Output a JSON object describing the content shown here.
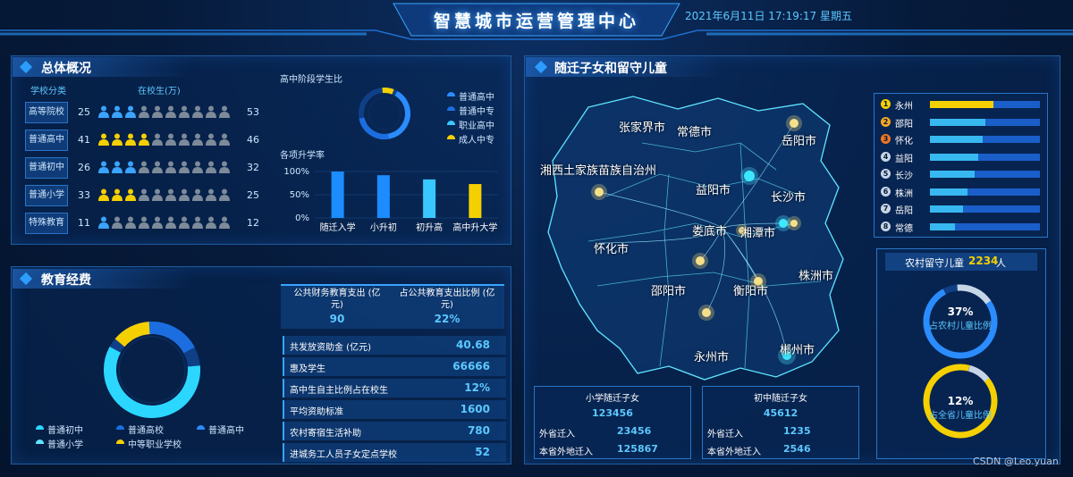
{
  "header": {
    "title": "智慧城市运营管理中心",
    "datetime": "2021年6月11日 17:19:17 星期五"
  },
  "overview": {
    "title": "总体概况",
    "col_category": "学校分类",
    "col_students": "在校生(万)",
    "rows": [
      {
        "label": "高等院校",
        "left": "25",
        "right": "53",
        "accent": "#3aa4ff"
      },
      {
        "label": "普通高中",
        "left": "41",
        "right": "46",
        "accent": "#f5d000"
      },
      {
        "label": "普通初中",
        "left": "26",
        "right": "32",
        "accent": "#3aa4ff"
      },
      {
        "label": "普通小学",
        "left": "33",
        "right": "25",
        "accent": "#f5d000"
      },
      {
        "label": "特殊教育",
        "left": "11",
        "right": "12",
        "accent": "#3aa4ff"
      }
    ],
    "donut_title": "高中阶段学生比",
    "donut_legend": [
      {
        "name": "普通高中",
        "color": "#2b8cff"
      },
      {
        "name": "普通中专",
        "color": "#1c6ee0"
      },
      {
        "name": "职业高中",
        "color": "#38c8ff"
      },
      {
        "name": "成人中专",
        "color": "#f5d000"
      }
    ],
    "bar_title": "各项升学率"
  },
  "chart_data": {
    "type": "bar",
    "categories": [
      "随迁入学",
      "小升初",
      "初升高",
      "高中升大学"
    ],
    "values": [
      100,
      92,
      83,
      73
    ],
    "colors": [
      "#1c8cff",
      "#1c8cff",
      "#38c8ff",
      "#f5d000"
    ],
    "ylim": [
      0,
      100
    ],
    "yticks": [
      "100%",
      "50%",
      "0%"
    ]
  },
  "education": {
    "title": "教育经费",
    "stat1_label": "公共财务教育支出 (亿元)",
    "stat1_value": "90",
    "stat2_label": "占公共教育支出比例 (亿元)",
    "stat2_value": "22%",
    "donut_legend": [
      {
        "name": "普通初中",
        "color": "#2bd7ff"
      },
      {
        "name": "普通高校",
        "color": "#1c6ee0"
      },
      {
        "name": "普通高中",
        "color": "#2b8cff"
      },
      {
        "name": "普通小学",
        "color": "#5fe6ff"
      },
      {
        "name": "中等职业学校",
        "color": "#f5d000"
      }
    ],
    "rows": [
      {
        "label": "共发放资助金 (亿元)",
        "value": "40.68"
      },
      {
        "label": "惠及学生",
        "value": "66666"
      },
      {
        "label": "高中生自主比例占在校生",
        "value": "12%"
      },
      {
        "label": "平均资助标准",
        "value": "1600"
      },
      {
        "label": "农村寄宿生活补助",
        "value": "780"
      },
      {
        "label": "进城务工人员子女定点学校",
        "value": "52"
      }
    ]
  },
  "children": {
    "title": "随迁子女和留守儿童",
    "map_labels": [
      "张家界市",
      "常德市",
      "岳阳市",
      "湘西土家族苗族自治州",
      "益阳市",
      "长沙市",
      "娄底市",
      "湘潭市",
      "怀化市",
      "邵阳市",
      "衡阳市",
      "株洲市",
      "永州市",
      "郴州市"
    ],
    "ranking": [
      {
        "rank": "1",
        "name": "永州",
        "fill": 0.58,
        "color": "#f5d000",
        "badge": "#f5d000"
      },
      {
        "rank": "2",
        "name": "邵阳",
        "fill": 0.5,
        "color": "#38b8f0",
        "badge": "#f5a623"
      },
      {
        "rank": "3",
        "name": "怀化",
        "fill": 0.48,
        "color": "#38b8f0",
        "badge": "#f07823"
      },
      {
        "rank": "4",
        "name": "益阳",
        "fill": 0.44,
        "color": "#38b8f0",
        "badge": "#c7d6e6"
      },
      {
        "rank": "5",
        "name": "长沙",
        "fill": 0.41,
        "color": "#38b8f0",
        "badge": "#c7d6e6"
      },
      {
        "rank": "6",
        "name": "株洲",
        "fill": 0.34,
        "color": "#38b8f0",
        "badge": "#c7d6e6"
      },
      {
        "rank": "7",
        "name": "岳阳",
        "fill": 0.3,
        "color": "#38b8f0",
        "badge": "#c7d6e6"
      },
      {
        "rank": "8",
        "name": "常德",
        "fill": 0.23,
        "color": "#38b8f0",
        "badge": "#c7d6e6"
      }
    ],
    "left_behind_label": "农村留守儿童",
    "left_behind_value": "2234",
    "left_behind_unit": "人",
    "ring1_percent": "37%",
    "ring1_label": "占农村儿童比例",
    "ring2_percent": "12%",
    "ring2_label": "占全省儿童比例",
    "primary_title": "小学随迁子女",
    "primary_value": "123456",
    "primary_rows": [
      {
        "label": "外省迁入",
        "value": "23456"
      },
      {
        "label": "本省外地迁入",
        "value": "125867"
      }
    ],
    "middle_title": "初中随迁子女",
    "middle_value": "45612",
    "middle_rows": [
      {
        "label": "外省迁入",
        "value": "1235"
      },
      {
        "label": "本省外地迁入",
        "value": "2546"
      }
    ]
  },
  "watermark": "CSDN @Leo.yuan"
}
